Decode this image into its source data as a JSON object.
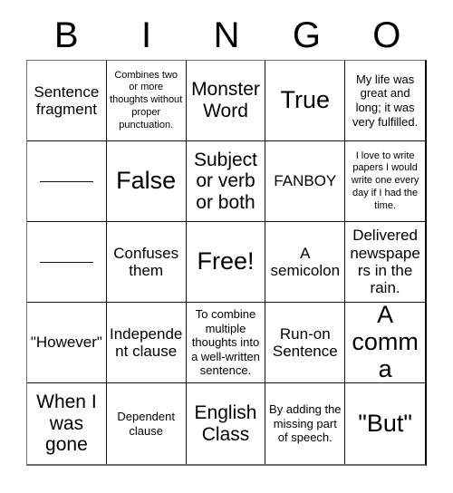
{
  "card": {
    "title": "BINGO",
    "header_letters": [
      "B",
      "I",
      "N",
      "G",
      "O"
    ],
    "columns": 5,
    "rows": 5,
    "border_color": "#111111",
    "text_color": "#000000",
    "background_color": "#ffffff",
    "free_space": {
      "row": 3,
      "column": 3,
      "label": "Free!"
    },
    "cells": [
      {
        "id": "r1c1",
        "text": "Sentence fragment",
        "size": "md",
        "blank": false
      },
      {
        "id": "r1c2",
        "text": "Combines two or more thoughts without proper punctuation.",
        "size": "xs",
        "blank": false
      },
      {
        "id": "r1c3",
        "text": "Monster Word",
        "size": "lg",
        "blank": false
      },
      {
        "id": "r1c4",
        "text": "True",
        "size": "xl",
        "blank": false
      },
      {
        "id": "r1c5",
        "text": "My life was great and long; it was very fulfilled.",
        "size": "sm",
        "blank": false
      },
      {
        "id": "r2c1",
        "text": "",
        "size": "md",
        "blank": true
      },
      {
        "id": "r2c2",
        "text": "False",
        "size": "xl",
        "blank": false
      },
      {
        "id": "r2c3",
        "text": "Subject or verb or both",
        "size": "lg",
        "blank": false
      },
      {
        "id": "r2c4",
        "text": "FANBOY",
        "size": "md",
        "blank": false
      },
      {
        "id": "r2c5",
        "text": "I love to write papers I would write one every day if I had the time.",
        "size": "xs",
        "blank": false
      },
      {
        "id": "r3c1",
        "text": "",
        "size": "md",
        "blank": true
      },
      {
        "id": "r3c2",
        "text": "Confuses them",
        "size": "md",
        "blank": false
      },
      {
        "id": "r3c3",
        "text": "Free!",
        "size": "xl",
        "blank": false
      },
      {
        "id": "r3c4",
        "text": "A semicolon",
        "size": "md",
        "blank": false
      },
      {
        "id": "r3c5",
        "text": "Delivered newspapers in the rain.",
        "size": "md",
        "blank": false
      },
      {
        "id": "r4c1",
        "text": "\"However\"",
        "size": "md",
        "blank": false
      },
      {
        "id": "r4c2",
        "text": "Independent clause",
        "size": "md",
        "blank": false
      },
      {
        "id": "r4c3",
        "text": "To combine multiple thoughts into a well-written sentence.",
        "size": "sm",
        "blank": false
      },
      {
        "id": "r4c4",
        "text": "Run-on Sentence",
        "size": "md",
        "blank": false
      },
      {
        "id": "r4c5",
        "text": "A comma",
        "size": "xl",
        "blank": false
      },
      {
        "id": "r5c1",
        "text": "When I was gone",
        "size": "lg",
        "blank": false
      },
      {
        "id": "r5c2",
        "text": "Dependent clause",
        "size": "sm",
        "blank": false
      },
      {
        "id": "r5c3",
        "text": "English Class",
        "size": "lg",
        "blank": false
      },
      {
        "id": "r5c4",
        "text": "By adding the missing part of speech.",
        "size": "sm",
        "blank": false
      },
      {
        "id": "r5c5",
        "text": "\"But\"",
        "size": "xl",
        "blank": false
      }
    ]
  }
}
